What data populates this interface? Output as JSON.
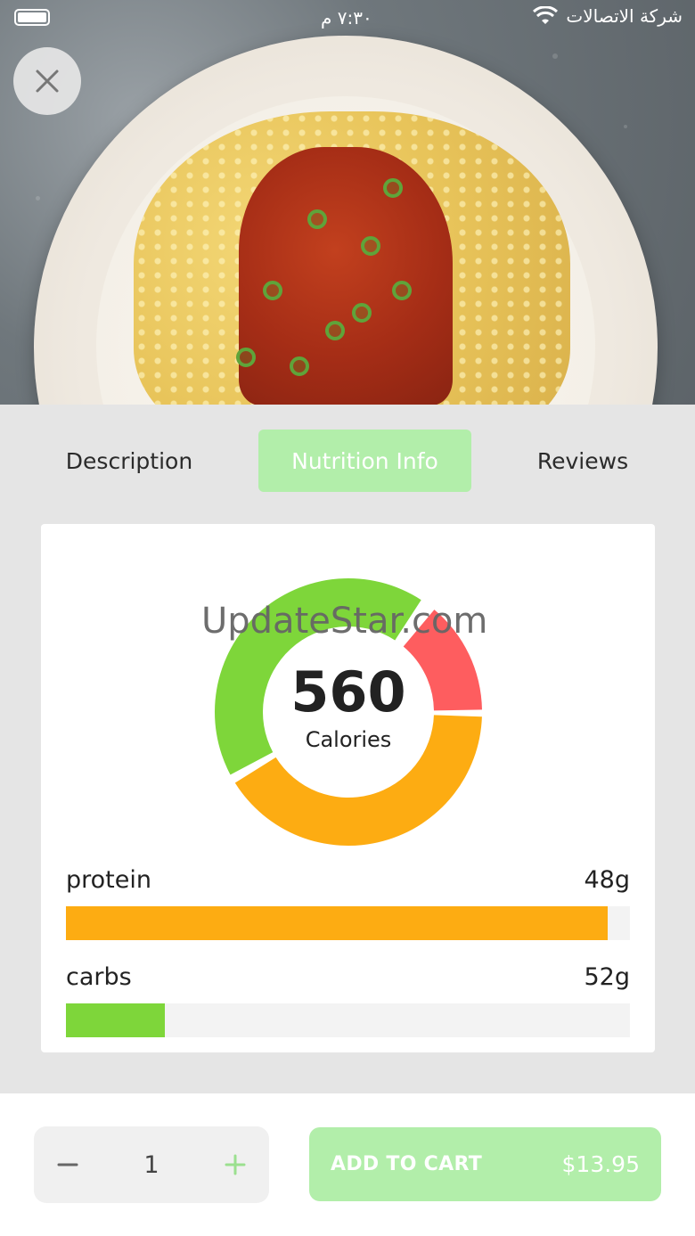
{
  "status_bar": {
    "time": "٧:٣٠ م",
    "carrier": "شركة الاتصالات",
    "icons": [
      "battery-icon",
      "wifi-icon"
    ]
  },
  "header": {
    "close_icon": "close-icon"
  },
  "tabs": [
    {
      "label": "Description",
      "active": false
    },
    {
      "label": "Nutrition Info",
      "active": true
    },
    {
      "label": "Reviews",
      "active": false
    }
  ],
  "nutrition": {
    "calories_value": "560",
    "calories_label": "Calories",
    "watermark": "UpdateStar.com",
    "donut_segments": [
      {
        "color": "#7ed63a",
        "start_deg": 242,
        "end_deg": 393
      },
      {
        "color": "#fe5d5f",
        "start_deg": 40,
        "end_deg": 89
      },
      {
        "color": "#fdac12",
        "start_deg": 92,
        "end_deg": 238
      }
    ],
    "items": [
      {
        "name": "protein",
        "amount": "48g",
        "fraction": 0.96,
        "color": "#fdac12"
      },
      {
        "name": "carbs",
        "amount": "52g",
        "fraction": 0.175,
        "color": "#7ed63a"
      }
    ]
  },
  "cart": {
    "quantity": "1",
    "decrement_icon": "minus-icon",
    "increment_icon": "plus-icon",
    "add_label": "ADD TO CART",
    "price": "$13.95"
  },
  "colors": {
    "accent": "#b2eeaa",
    "green": "#7ed63a",
    "orange": "#fdac12",
    "red": "#fe5d5f"
  }
}
